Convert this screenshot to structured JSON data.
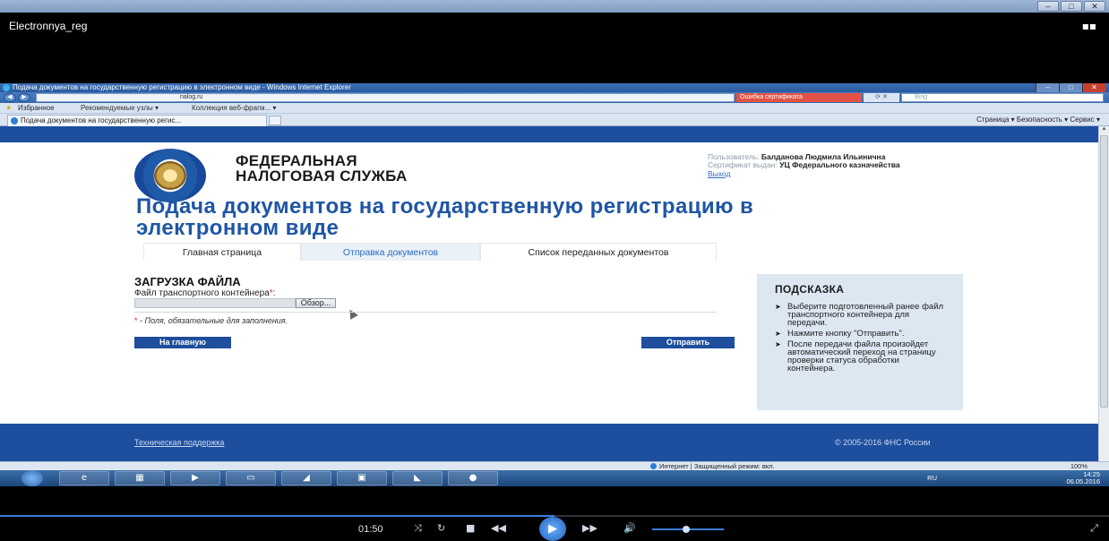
{
  "player": {
    "name": "Electronnya_reg",
    "time": "01:50",
    "progress": 0.5
  },
  "browser": {
    "window_title": "Подача документов на государственную регистрацию в электронном виде - Windows Internet Explorer",
    "url": "nalog.ru",
    "cert_error": "Ошибка сертификата",
    "search_placeholder": "Bing",
    "favorites_label": "Избранное",
    "fav_link_1": "Рекомендуемые узлы ▾",
    "fav_link_2": "Коллекция веб-фрагм... ▾",
    "tab_title": "Подача документов на государственную регис...",
    "command_bar": "Страница ▾   Безопасность ▾   Сервис ▾",
    "status_zone": "Интернет | Защищенный режим: вкл.",
    "zoom": "100%"
  },
  "page": {
    "org_line1": "ФЕДЕРАЛЬНАЯ",
    "org_line2": "НАЛОГОВАЯ СЛУЖБА",
    "user_label": "Пользователь:",
    "user_name": "Балданова Людмила Ильинична",
    "cert_label": "Сертификат выдан:",
    "cert_issuer": "УЦ Федерального казначейства",
    "logout": "Выход",
    "title": "Подача документов на государственную регистрацию в электронном виде",
    "tabs": [
      {
        "label": "Главная страница"
      },
      {
        "label": "Отправка документов"
      },
      {
        "label": "Список переданных документов"
      }
    ],
    "upload_heading": "ЗАГРУЗКА ФАЙЛА",
    "file_label": "Файл транспортного контейнера",
    "required_mark": "*",
    "browse_button": "Обзор...",
    "required_note": "- Поля, обязательные для заполнения.",
    "home_button": "На главную",
    "send_button": "Отправить",
    "hint_title": "ПОДСКАЗКА",
    "hint_items": [
      "Выберите подготовленный ранее файл транспортного контейнера для передачи.",
      "Нажмите кнопку \"Отправить\".",
      "После передачи файла произойдет автоматический переход на страницу проверки статуса обработки контейнера."
    ],
    "support_link": "Техническая поддержка",
    "copyright": "© 2005-2016 ФНС России"
  },
  "taskbar": {
    "lang": "RU",
    "time": "14:25",
    "date": "06.05.2016"
  }
}
